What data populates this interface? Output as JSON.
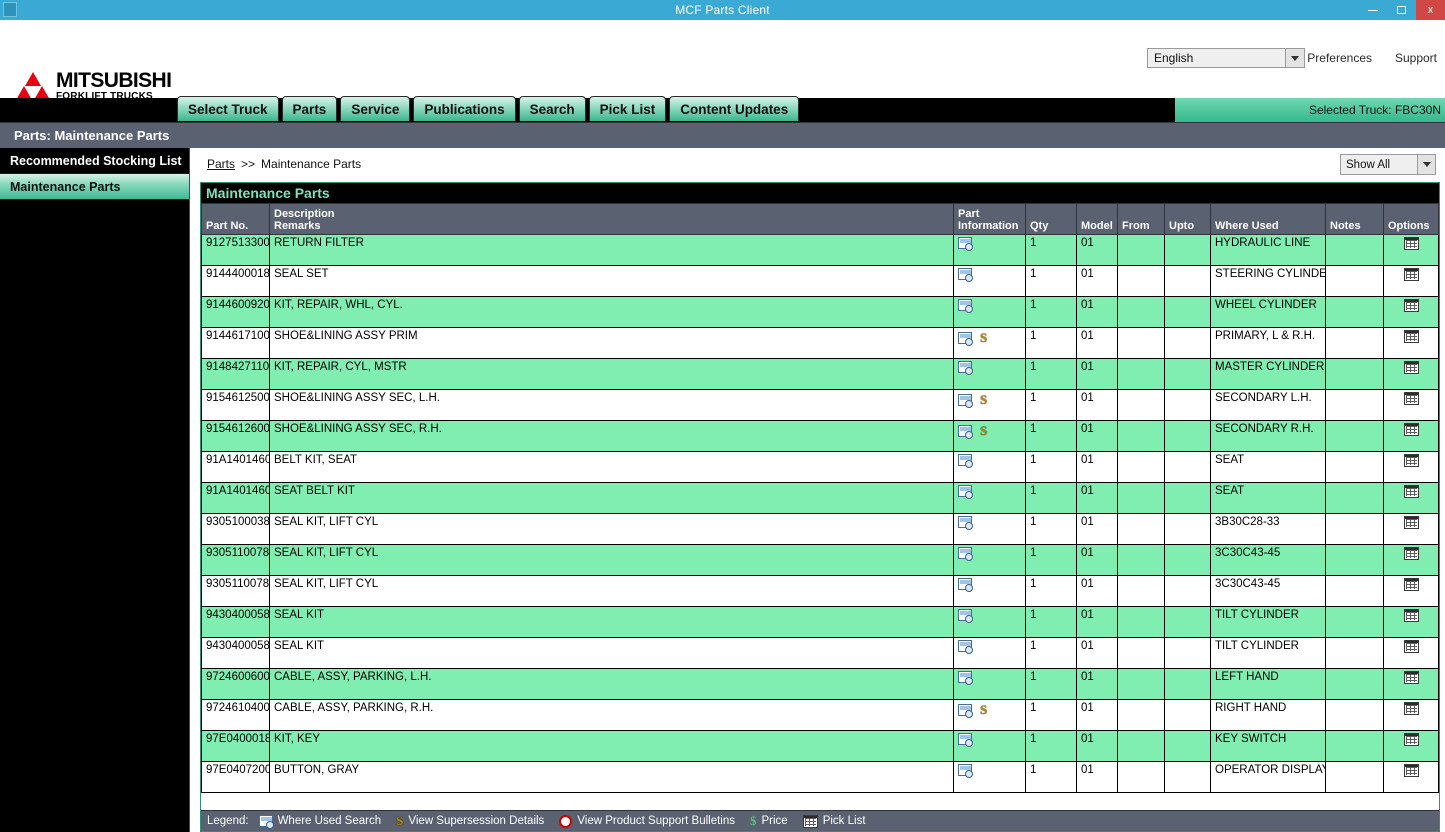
{
  "window": {
    "title": "MCF Parts Client",
    "minimize_label": "minimize",
    "maximize_label": "maximize",
    "close_label": "x"
  },
  "header": {
    "logo_line1": "MITSUBISHI",
    "logo_line2": "FORKLIFT TRUCKS",
    "language": "English",
    "preferences_label": "Preferences",
    "support_label": "Support",
    "selected_truck": "Selected Truck:  FBC30N"
  },
  "tabs": [
    {
      "label": "Select Truck"
    },
    {
      "label": "Parts"
    },
    {
      "label": "Service"
    },
    {
      "label": "Publications"
    },
    {
      "label": "Search"
    },
    {
      "label": "Pick List"
    },
    {
      "label": "Content Updates"
    }
  ],
  "page_title": "Parts: Maintenance Parts",
  "sidebar": {
    "items": [
      {
        "label": "Recommended Stocking List",
        "active": false
      },
      {
        "label": "Maintenance Parts",
        "active": true
      }
    ]
  },
  "breadcrumb": {
    "root": "Parts",
    "separator": ">>",
    "current": "Maintenance Parts"
  },
  "filter": {
    "show_all": "Show All"
  },
  "panel": {
    "title": "Maintenance Parts"
  },
  "table": {
    "headers": {
      "part_no": "Part No.",
      "description": "Description",
      "remarks": "Remarks",
      "part_information_1": "Part",
      "part_information_2": "Information",
      "qty": "Qty",
      "model": "Model",
      "from": "From",
      "upto": "Upto",
      "where_used": "Where Used",
      "notes": "Notes",
      "options": "Options"
    },
    "rows": [
      {
        "part_no": "9127513300",
        "description": "RETURN FILTER",
        "supersession": false,
        "qty": "1",
        "model": "01",
        "from": "",
        "upto": "",
        "where_used": "HYDRAULIC LINE",
        "notes": ""
      },
      {
        "part_no": "9144400018",
        "description": "SEAL SET",
        "supersession": false,
        "qty": "1",
        "model": "01",
        "from": "",
        "upto": "",
        "where_used": "STEERING CYLINDER",
        "notes": ""
      },
      {
        "part_no": "9144600920",
        "description": "KIT, REPAIR, WHL, CYL.",
        "supersession": false,
        "qty": "1",
        "model": "01",
        "from": "",
        "upto": "",
        "where_used": "WHEEL CYLINDER",
        "notes": ""
      },
      {
        "part_no": "9144617100",
        "description": "SHOE&LINING ASSY PRIM",
        "supersession": true,
        "qty": "1",
        "model": "01",
        "from": "",
        "upto": "",
        "where_used": "PRIMARY, L & R.H.",
        "notes": ""
      },
      {
        "part_no": "9148427110",
        "description": "KIT, REPAIR, CYL, MSTR",
        "supersession": false,
        "qty": "1",
        "model": "01",
        "from": "",
        "upto": "",
        "where_used": "MASTER CYLINDER",
        "notes": ""
      },
      {
        "part_no": "9154612500",
        "description": "SHOE&LINING ASSY SEC, L.H.",
        "supersession": true,
        "qty": "1",
        "model": "01",
        "from": "",
        "upto": "",
        "where_used": "SECONDARY L.H.",
        "notes": ""
      },
      {
        "part_no": "9154612600",
        "description": "SHOE&LINING ASSY SEC, R.H.",
        "supersession": true,
        "qty": "1",
        "model": "01",
        "from": "",
        "upto": "",
        "where_used": "SECONDARY R.H.",
        "notes": ""
      },
      {
        "part_no": "91A1401460",
        "description": "BELT KIT, SEAT",
        "supersession": false,
        "qty": "1",
        "model": "01",
        "from": "",
        "upto": "",
        "where_used": "SEAT",
        "notes": ""
      },
      {
        "part_no": "91A1401460",
        "description": "SEAT BELT KIT",
        "supersession": false,
        "qty": "1",
        "model": "01",
        "from": "",
        "upto": "",
        "where_used": "SEAT",
        "notes": ""
      },
      {
        "part_no": "9305100038",
        "description": "SEAL KIT, LIFT CYL",
        "supersession": false,
        "qty": "1",
        "model": "01",
        "from": "",
        "upto": "",
        "where_used": "3B30C28-33",
        "notes": ""
      },
      {
        "part_no": "9305110078",
        "description": "SEAL KIT, LIFT CYL",
        "supersession": false,
        "qty": "1",
        "model": "01",
        "from": "",
        "upto": "",
        "where_used": "3C30C43-45",
        "notes": ""
      },
      {
        "part_no": "9305110078",
        "description": "SEAL KIT, LIFT CYL",
        "supersession": false,
        "qty": "1",
        "model": "01",
        "from": "",
        "upto": "",
        "where_used": "3C30C43-45",
        "notes": ""
      },
      {
        "part_no": "9430400058",
        "description": "SEAL KIT",
        "supersession": false,
        "qty": "1",
        "model": "01",
        "from": "",
        "upto": "",
        "where_used": "TILT CYLINDER",
        "notes": ""
      },
      {
        "part_no": "9430400058",
        "description": "SEAL KIT",
        "supersession": false,
        "qty": "1",
        "model": "01",
        "from": "",
        "upto": "",
        "where_used": "TILT CYLINDER",
        "notes": ""
      },
      {
        "part_no": "9724600600",
        "description": "CABLE, ASSY, PARKING, L.H.",
        "supersession": false,
        "qty": "1",
        "model": "01",
        "from": "",
        "upto": "",
        "where_used": "LEFT HAND",
        "notes": ""
      },
      {
        "part_no": "9724610400",
        "description": "CABLE, ASSY, PARKING, R.H.",
        "supersession": true,
        "qty": "1",
        "model": "01",
        "from": "",
        "upto": "",
        "where_used": "RIGHT HAND",
        "notes": ""
      },
      {
        "part_no": "97E0400018",
        "description": "KIT, KEY",
        "supersession": false,
        "qty": "1",
        "model": "01",
        "from": "",
        "upto": "",
        "where_used": "KEY SWITCH",
        "notes": ""
      },
      {
        "part_no": "97E0407200",
        "description": "BUTTON, GRAY",
        "supersession": false,
        "qty": "1",
        "model": "01",
        "from": "",
        "upto": "",
        "where_used": "OPERATOR DISPLAY",
        "notes": ""
      }
    ]
  },
  "legend": {
    "label": "Legend:",
    "items": [
      {
        "icon": "where-used-search-icon",
        "label": "Where Used Search"
      },
      {
        "icon": "supersession-icon",
        "label": "View Supersession Details"
      },
      {
        "icon": "product-bulletin-icon",
        "label": "View Product Support Bulletins"
      },
      {
        "icon": "price-icon",
        "label": "Price"
      },
      {
        "icon": "pick-list-icon",
        "label": "Pick List"
      }
    ]
  },
  "colors": {
    "titlebar": "#3aa9d4",
    "close_button": "#cf4844",
    "tab_gradient_end": "#3cb58c",
    "row_highlight": "#80eeb1",
    "header_slate": "#5a6170",
    "panel_title_text": "#7fe0bc",
    "logo_red": "#e60012"
  }
}
